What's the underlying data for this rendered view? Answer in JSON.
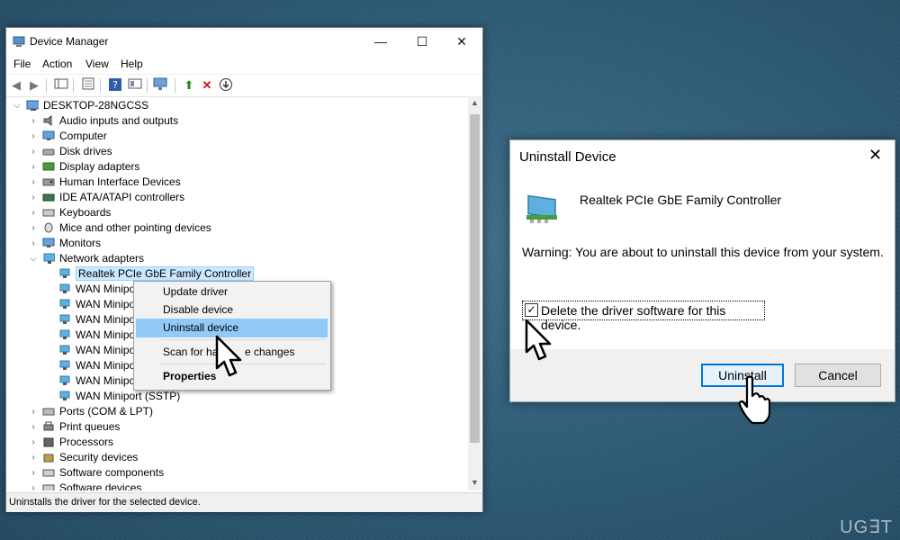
{
  "device_manager": {
    "title": "Device Manager",
    "controls": {
      "minimize": "—",
      "maximize": "☐",
      "close": "✕"
    },
    "menu": [
      "File",
      "Action",
      "View",
      "Help"
    ],
    "tree": {
      "root": "DESKTOP-28NGCSS",
      "categories_before": [
        {
          "label": "Audio inputs and outputs",
          "icon": "speaker-icon"
        },
        {
          "label": "Computer",
          "icon": "monitor-icon"
        },
        {
          "label": "Disk drives",
          "icon": "disk-icon"
        },
        {
          "label": "Display adapters",
          "icon": "display-icon"
        },
        {
          "label": "Human Interface Devices",
          "icon": "hid-icon"
        },
        {
          "label": "IDE ATA/ATAPI controllers",
          "icon": "ide-icon"
        },
        {
          "label": "Keyboards",
          "icon": "keyboard-icon"
        },
        {
          "label": "Mice and other pointing devices",
          "icon": "mouse-icon"
        },
        {
          "label": "Monitors",
          "icon": "monitor-icon"
        }
      ],
      "network_adapters": {
        "label": "Network adapters",
        "children": [
          "Realtek PCIe GbE Family Controller",
          "WAN Minipo",
          "WAN Minipo",
          "WAN Minipo",
          "WAN Minipo",
          "WAN Minipo",
          "WAN Minipo",
          "WAN Minipo",
          "WAN Miniport (SSTP)"
        ]
      },
      "categories_after": [
        {
          "label": "Ports (COM & LPT)",
          "icon": "port-icon"
        },
        {
          "label": "Print queues",
          "icon": "printer-icon"
        },
        {
          "label": "Processors",
          "icon": "processor-icon"
        },
        {
          "label": "Security devices",
          "icon": "security-icon"
        },
        {
          "label": "Software components",
          "icon": "software-icon"
        },
        {
          "label": "Software devices",
          "icon": "software-icon"
        }
      ]
    },
    "status": "Uninstalls the driver for the selected device."
  },
  "context_menu": {
    "items": [
      "Update driver",
      "Disable device",
      "Uninstall device",
      "Scan for hardware changes",
      "Properties"
    ],
    "highlighted": "Uninstall device",
    "scan_visible_parts": [
      "Scan for ha",
      "e changes"
    ]
  },
  "dialog": {
    "title": "Uninstall Device",
    "device_name": "Realtek PCIe GbE Family Controller",
    "warning": "Warning: You are about to uninstall this device from your system.",
    "checkbox_label": "Delete the driver software for this device.",
    "checkbox_checked": true,
    "uninstall_label": "Uninstall",
    "cancel_label": "Cancel"
  },
  "watermark": "UG∃T",
  "colors": {
    "selection": "#cce8ff",
    "menu_highlight": "#91c9f7",
    "default_button_border": "#0078d7"
  }
}
